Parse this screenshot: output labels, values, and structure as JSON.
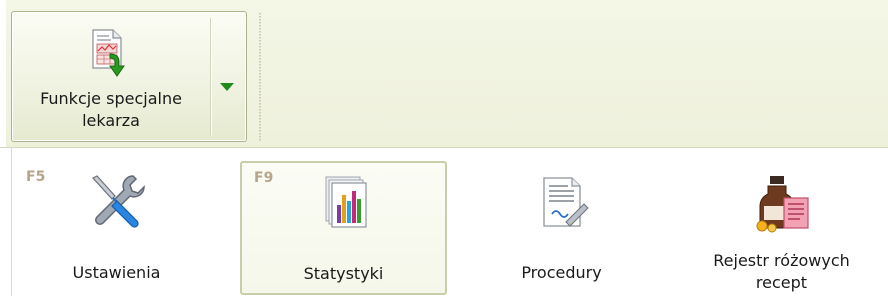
{
  "ribbon": {
    "special_functions": {
      "label_line1": "Funkcje specjalne",
      "label_line2": "lekarza",
      "icon": "report-download-icon"
    }
  },
  "menu": {
    "items": [
      {
        "key": "F5",
        "label": "Ustawienia",
        "icon": "tools-icon",
        "selected": false
      },
      {
        "key": "F9",
        "label": "Statystyki",
        "icon": "statistics-icon",
        "selected": true
      },
      {
        "key": "",
        "label": "Procedury",
        "icon": "procedures-icon",
        "selected": false
      },
      {
        "key": "",
        "label_line1": "Rejestr różowych",
        "label_line2": "recept",
        "icon": "pink-prescriptions-icon",
        "selected": false
      }
    ]
  },
  "colors": {
    "ribbon_bg": "#eef1dc",
    "accent_green": "#1f8a1a",
    "selected_border": "#c7cfa8",
    "shortcut_key": "#b5a58a"
  }
}
